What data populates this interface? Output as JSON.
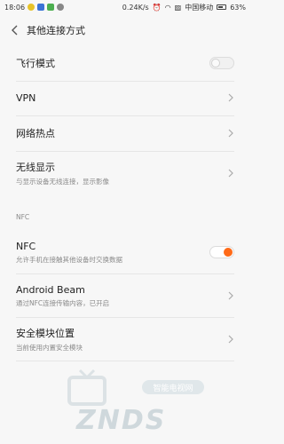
{
  "status_bar": {
    "time": "18:06",
    "speed": "0.24K/s",
    "carrier": "中国移动",
    "battery": "63%"
  },
  "header": {
    "title": "其他连接方式"
  },
  "settings": {
    "airplane": {
      "title": "飞行模式",
      "enabled": false
    },
    "vpn": {
      "title": "VPN"
    },
    "hotspot": {
      "title": "网络热点"
    },
    "wireless_display": {
      "title": "无线显示",
      "subtitle": "与显示设备无线连接，显示影像"
    },
    "section_nfc": "NFC",
    "nfc": {
      "title": "NFC",
      "subtitle": "允许手机在接触其他设备时交换数据",
      "enabled": true
    },
    "android_beam": {
      "title": "Android Beam",
      "subtitle": "通过NFC连接传输内容，已开启"
    },
    "secure_element": {
      "title": "安全模块位置",
      "subtitle": "当前使用内置安全模块"
    }
  },
  "watermark": {
    "text": "ZNDS",
    "badge": "智能电视网"
  },
  "colors": {
    "accent": "#ff6a18",
    "background": "#f7f7f7"
  }
}
